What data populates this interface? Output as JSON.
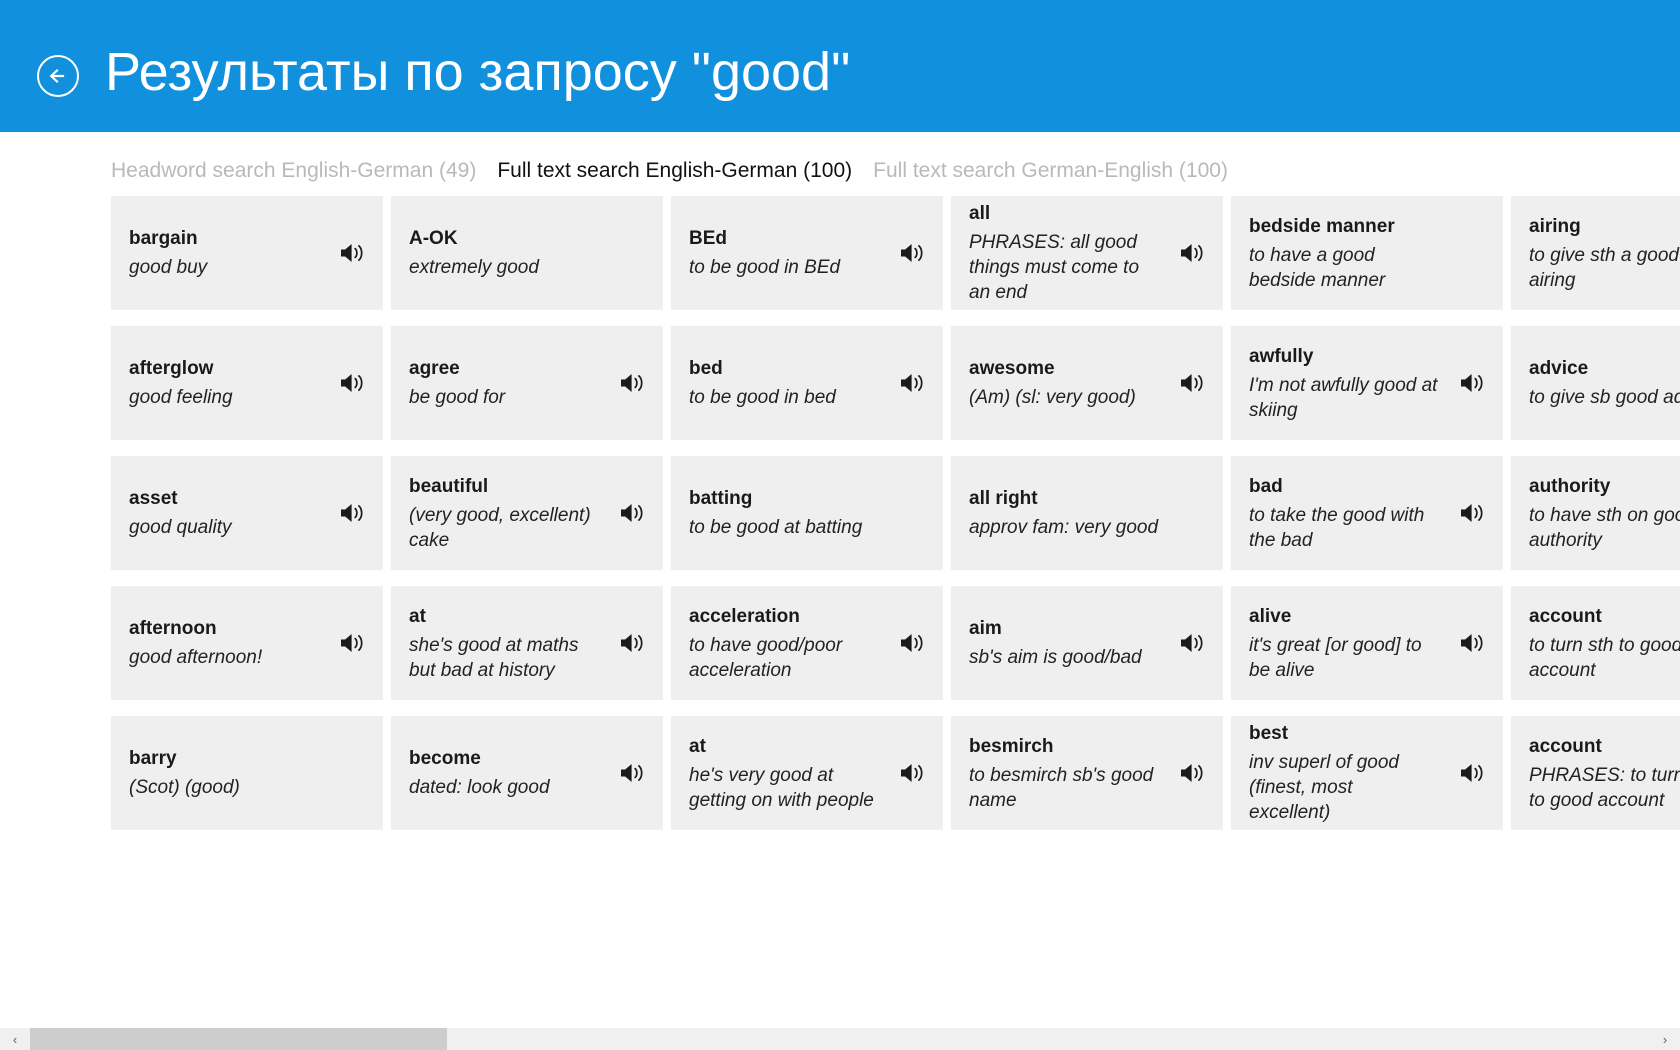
{
  "theme": {
    "header_blue": "#1190de",
    "card_bg": "#efefef",
    "active_tab_color": "#111111",
    "inactive_tab_color": "#b9b9b9",
    "scroll_thumb": "#cdcdcd",
    "scroll_track": "#f0f0f0"
  },
  "header": {
    "title": "Результаты по запросу  \"good\"",
    "back_icon": "back-arrow-circle-icon"
  },
  "tabs": [
    {
      "label": "Headword search English-German (49)",
      "active": false
    },
    {
      "label": "Full text search English-German (100)",
      "active": true
    },
    {
      "label": "Full text search German-English (100)",
      "active": false
    }
  ],
  "scrollbar": {
    "left_arrow": "‹",
    "right_arrow": "›"
  },
  "speaker_icon_name": "speaker-icon",
  "results": [
    {
      "term": "bargain",
      "sense": "good buy",
      "speaker": true
    },
    {
      "term": "afterglow",
      "sense": "good feeling",
      "speaker": true
    },
    {
      "term": "asset",
      "sense": "good quality",
      "speaker": true
    },
    {
      "term": "afternoon",
      "sense": "good afternoon!",
      "speaker": true
    },
    {
      "term": "barry",
      "sense": "(Scot) (good)",
      "speaker": false
    },
    {
      "term": "A-OK",
      "sense": "extremely good",
      "speaker": false
    },
    {
      "term": "agree",
      "sense": "be good for",
      "speaker": true
    },
    {
      "term": "beautiful",
      "sense": "(very good, excellent) cake",
      "speaker": true
    },
    {
      "term": "at",
      "sense": "she's good at maths but bad at history",
      "speaker": true
    },
    {
      "term": "become",
      "sense": "dated: look good",
      "speaker": true
    },
    {
      "term": "BEd",
      "sense": "to be good in BEd",
      "speaker": true
    },
    {
      "term": "bed",
      "sense": "to be good in bed",
      "speaker": true
    },
    {
      "term": "batting",
      "sense": "to be good at batting",
      "speaker": false
    },
    {
      "term": "acceleration",
      "sense": "to have good/poor acceleration",
      "speaker": true
    },
    {
      "term": "at",
      "sense": "he's very good at getting on with people",
      "speaker": true
    },
    {
      "term": "all",
      "sense": "PHRASES: all good things must come to an end",
      "speaker": true
    },
    {
      "term": "awesome",
      "sense": "(Am) (sl: very good)",
      "speaker": true
    },
    {
      "term": "all right",
      "sense": "approv fam: very good",
      "speaker": false
    },
    {
      "term": "aim",
      "sense": "sb's aim is good/bad",
      "speaker": true
    },
    {
      "term": "besmirch",
      "sense": "to besmirch sb's good name",
      "speaker": true
    },
    {
      "term": "bedside manner",
      "sense": "to have a good bedside manner",
      "speaker": false
    },
    {
      "term": "awfully",
      "sense": "I'm not awfully good at skiing",
      "speaker": true
    },
    {
      "term": "bad",
      "sense": "to take the good with the bad",
      "speaker": true
    },
    {
      "term": "alive",
      "sense": "it's great [or good] to be alive",
      "speaker": true
    },
    {
      "term": "best",
      "sense": "inv superl of good (finest, most excellent)",
      "speaker": true
    },
    {
      "term": "airing",
      "sense": "to give sth a good airing",
      "speaker": false
    },
    {
      "term": "advice",
      "sense": "to give sb good advice",
      "speaker": false
    },
    {
      "term": "authority",
      "sense": "to have sth on good authority",
      "speaker": false
    },
    {
      "term": "account",
      "sense": "to turn sth to good account",
      "speaker": false
    },
    {
      "term": "account",
      "sense": "PHRASES: to turn sth to good account",
      "speaker": false
    }
  ]
}
